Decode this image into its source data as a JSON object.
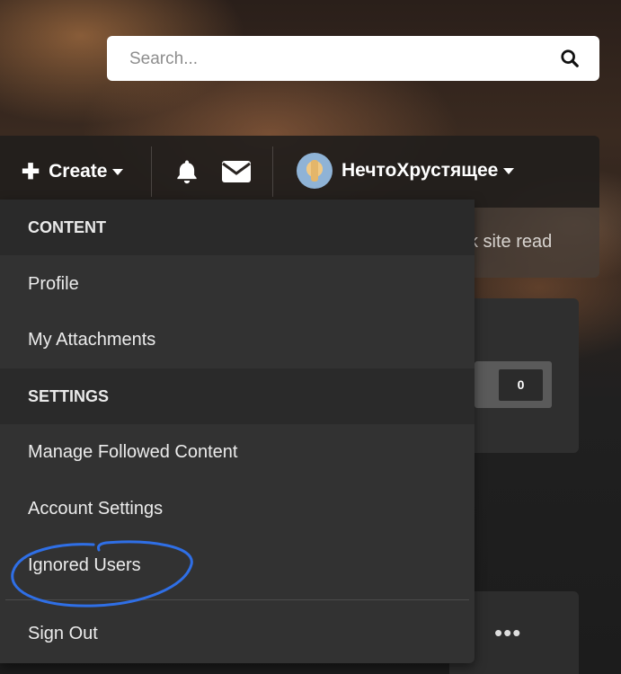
{
  "search": {
    "placeholder": "Search..."
  },
  "navbar": {
    "create_label": "Create",
    "username": "НечтоХрустящее"
  },
  "background": {
    "panel_text": "k site read",
    "counter": "0",
    "more": "•••"
  },
  "menu": {
    "sections": [
      {
        "title": "CONTENT",
        "items": [
          "Profile",
          "My Attachments"
        ]
      },
      {
        "title": "SETTINGS",
        "items": [
          "Manage Followed Content",
          "Account Settings",
          "Ignored Users"
        ]
      }
    ],
    "signout": "Sign Out"
  },
  "annotation": {
    "color": "#2f6fe6",
    "target": "Ignored Users"
  }
}
